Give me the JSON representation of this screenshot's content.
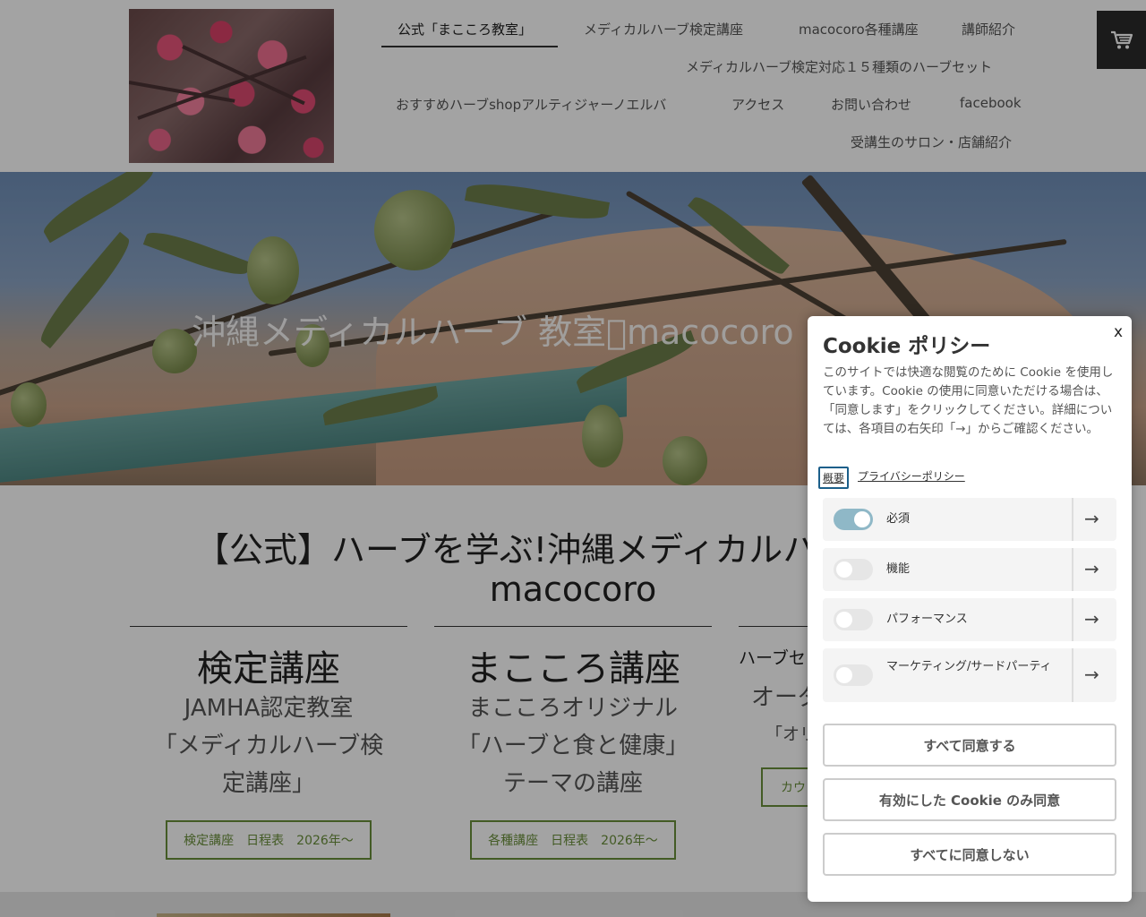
{
  "nav": {
    "items": [
      "公式「まこころ教室」",
      "メディカルハーブ検定講座",
      "macocoro各種講座",
      "講師紹介",
      "メディカルハーブ検定対応１５種類のハーブセット",
      "おすすめハーブshopアルティジャーノエルバ",
      "アクセス",
      "お問い合わせ",
      "facebook",
      "受講生のサロン・店舗紹介"
    ],
    "active_index": 0
  },
  "cart": {
    "icon": "cart-icon"
  },
  "hero": {
    "title": "沖縄メディカルハーブ 教室\u0000macocoro まこころ"
  },
  "main": {
    "title_line1": "【公式】ハーブを学ぶ!沖縄メディカルハーブ教室",
    "title_line2": "macocoro",
    "columns": [
      {
        "heading": "検定講座",
        "sub": [
          "JAMHA認定教室",
          "「メディカルハーブ検",
          "定講座」"
        ],
        "button": "検定講座　日程表　2026年～"
      },
      {
        "heading": "まこころ講座",
        "sub": [
          "まこころオリジナル",
          "「ハーブと食と健康」",
          "テーマの講座"
        ],
        "button": "各種講座　日程表　2026年～"
      },
      {
        "heading": "ハーブセ",
        "sub": [
          "オーダ",
          "「オリ"
        ],
        "button": "カウ"
      }
    ]
  },
  "cookie": {
    "close": "x",
    "title": "Cookie ポリシー",
    "text": "このサイトでは快適な閲覧のために Cookie を使用しています。Cookie の使用に同意いただける場合は、「同意します」をクリックしてください。詳細については、各項目の右矢印「→」からご確認ください。",
    "tabs": [
      "概要",
      "プライバシーポリシー"
    ],
    "prefs": [
      {
        "label": "必須",
        "on": true
      },
      {
        "label": "機能",
        "on": false
      },
      {
        "label": "パフォーマンス",
        "on": false
      },
      {
        "label": "マーケティング/サードパーティ",
        "on": false
      }
    ],
    "arrow": "→",
    "buttons": {
      "accept_all": "すべて同意する",
      "accept_selected": "有効にした Cookie のみ同意",
      "reject_all": "すべてに同意しない"
    }
  },
  "colors": {
    "accent_green": "#6a8f3a",
    "toggle_on": "#8fb8c7",
    "focus_blue": "#1c5f8a",
    "cart_bg": "#2b2b2b"
  }
}
